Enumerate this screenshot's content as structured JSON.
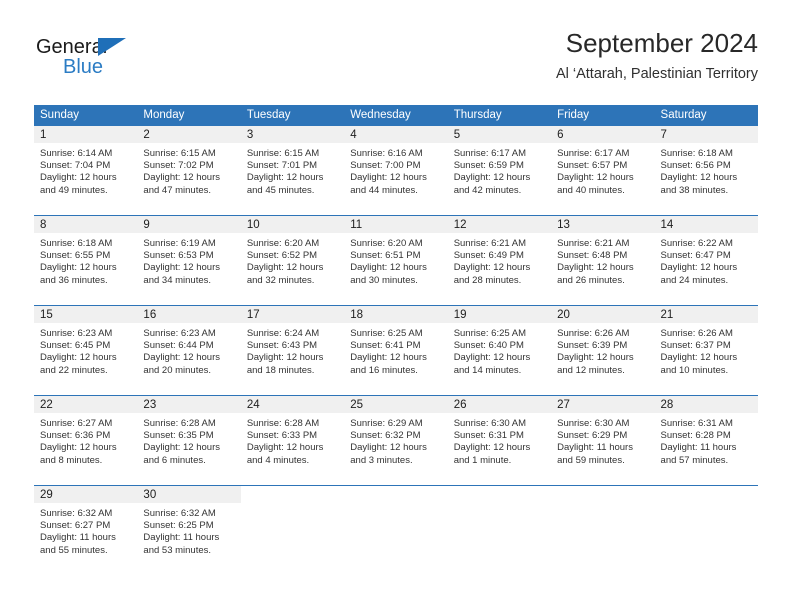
{
  "brand": {
    "name_top": "General",
    "name_bottom": "Blue",
    "triangle_color": "#1f6fb8",
    "blue_text_color": "#2b7cc4"
  },
  "header": {
    "title": "September 2024",
    "subtitle": "Al ‘Attarah, Palestinian Territory"
  },
  "theme": {
    "header_blue": "#2d74b8",
    "day_band_gray": "#f0f0f0",
    "text_color": "#333333"
  },
  "weekdays": [
    "Sunday",
    "Monday",
    "Tuesday",
    "Wednesday",
    "Thursday",
    "Friday",
    "Saturday"
  ],
  "weeks": [
    [
      {
        "day": "1",
        "sunrise": "Sunrise: 6:14 AM",
        "sunset": "Sunset: 7:04 PM",
        "daylight": "Daylight: 12 hours and 49 minutes."
      },
      {
        "day": "2",
        "sunrise": "Sunrise: 6:15 AM",
        "sunset": "Sunset: 7:02 PM",
        "daylight": "Daylight: 12 hours and 47 minutes."
      },
      {
        "day": "3",
        "sunrise": "Sunrise: 6:15 AM",
        "sunset": "Sunset: 7:01 PM",
        "daylight": "Daylight: 12 hours and 45 minutes."
      },
      {
        "day": "4",
        "sunrise": "Sunrise: 6:16 AM",
        "sunset": "Sunset: 7:00 PM",
        "daylight": "Daylight: 12 hours and 44 minutes."
      },
      {
        "day": "5",
        "sunrise": "Sunrise: 6:17 AM",
        "sunset": "Sunset: 6:59 PM",
        "daylight": "Daylight: 12 hours and 42 minutes."
      },
      {
        "day": "6",
        "sunrise": "Sunrise: 6:17 AM",
        "sunset": "Sunset: 6:57 PM",
        "daylight": "Daylight: 12 hours and 40 minutes."
      },
      {
        "day": "7",
        "sunrise": "Sunrise: 6:18 AM",
        "sunset": "Sunset: 6:56 PM",
        "daylight": "Daylight: 12 hours and 38 minutes."
      }
    ],
    [
      {
        "day": "8",
        "sunrise": "Sunrise: 6:18 AM",
        "sunset": "Sunset: 6:55 PM",
        "daylight": "Daylight: 12 hours and 36 minutes."
      },
      {
        "day": "9",
        "sunrise": "Sunrise: 6:19 AM",
        "sunset": "Sunset: 6:53 PM",
        "daylight": "Daylight: 12 hours and 34 minutes."
      },
      {
        "day": "10",
        "sunrise": "Sunrise: 6:20 AM",
        "sunset": "Sunset: 6:52 PM",
        "daylight": "Daylight: 12 hours and 32 minutes."
      },
      {
        "day": "11",
        "sunrise": "Sunrise: 6:20 AM",
        "sunset": "Sunset: 6:51 PM",
        "daylight": "Daylight: 12 hours and 30 minutes."
      },
      {
        "day": "12",
        "sunrise": "Sunrise: 6:21 AM",
        "sunset": "Sunset: 6:49 PM",
        "daylight": "Daylight: 12 hours and 28 minutes."
      },
      {
        "day": "13",
        "sunrise": "Sunrise: 6:21 AM",
        "sunset": "Sunset: 6:48 PM",
        "daylight": "Daylight: 12 hours and 26 minutes."
      },
      {
        "day": "14",
        "sunrise": "Sunrise: 6:22 AM",
        "sunset": "Sunset: 6:47 PM",
        "daylight": "Daylight: 12 hours and 24 minutes."
      }
    ],
    [
      {
        "day": "15",
        "sunrise": "Sunrise: 6:23 AM",
        "sunset": "Sunset: 6:45 PM",
        "daylight": "Daylight: 12 hours and 22 minutes."
      },
      {
        "day": "16",
        "sunrise": "Sunrise: 6:23 AM",
        "sunset": "Sunset: 6:44 PM",
        "daylight": "Daylight: 12 hours and 20 minutes."
      },
      {
        "day": "17",
        "sunrise": "Sunrise: 6:24 AM",
        "sunset": "Sunset: 6:43 PM",
        "daylight": "Daylight: 12 hours and 18 minutes."
      },
      {
        "day": "18",
        "sunrise": "Sunrise: 6:25 AM",
        "sunset": "Sunset: 6:41 PM",
        "daylight": "Daylight: 12 hours and 16 minutes."
      },
      {
        "day": "19",
        "sunrise": "Sunrise: 6:25 AM",
        "sunset": "Sunset: 6:40 PM",
        "daylight": "Daylight: 12 hours and 14 minutes."
      },
      {
        "day": "20",
        "sunrise": "Sunrise: 6:26 AM",
        "sunset": "Sunset: 6:39 PM",
        "daylight": "Daylight: 12 hours and 12 minutes."
      },
      {
        "day": "21",
        "sunrise": "Sunrise: 6:26 AM",
        "sunset": "Sunset: 6:37 PM",
        "daylight": "Daylight: 12 hours and 10 minutes."
      }
    ],
    [
      {
        "day": "22",
        "sunrise": "Sunrise: 6:27 AM",
        "sunset": "Sunset: 6:36 PM",
        "daylight": "Daylight: 12 hours and 8 minutes."
      },
      {
        "day": "23",
        "sunrise": "Sunrise: 6:28 AM",
        "sunset": "Sunset: 6:35 PM",
        "daylight": "Daylight: 12 hours and 6 minutes."
      },
      {
        "day": "24",
        "sunrise": "Sunrise: 6:28 AM",
        "sunset": "Sunset: 6:33 PM",
        "daylight": "Daylight: 12 hours and 4 minutes."
      },
      {
        "day": "25",
        "sunrise": "Sunrise: 6:29 AM",
        "sunset": "Sunset: 6:32 PM",
        "daylight": "Daylight: 12 hours and 3 minutes."
      },
      {
        "day": "26",
        "sunrise": "Sunrise: 6:30 AM",
        "sunset": "Sunset: 6:31 PM",
        "daylight": "Daylight: 12 hours and 1 minute."
      },
      {
        "day": "27",
        "sunrise": "Sunrise: 6:30 AM",
        "sunset": "Sunset: 6:29 PM",
        "daylight": "Daylight: 11 hours and 59 minutes."
      },
      {
        "day": "28",
        "sunrise": "Sunrise: 6:31 AM",
        "sunset": "Sunset: 6:28 PM",
        "daylight": "Daylight: 11 hours and 57 minutes."
      }
    ],
    [
      {
        "day": "29",
        "sunrise": "Sunrise: 6:32 AM",
        "sunset": "Sunset: 6:27 PM",
        "daylight": "Daylight: 11 hours and 55 minutes."
      },
      {
        "day": "30",
        "sunrise": "Sunrise: 6:32 AM",
        "sunset": "Sunset: 6:25 PM",
        "daylight": "Daylight: 11 hours and 53 minutes."
      },
      {
        "day": "",
        "sunrise": "",
        "sunset": "",
        "daylight": ""
      },
      {
        "day": "",
        "sunrise": "",
        "sunset": "",
        "daylight": ""
      },
      {
        "day": "",
        "sunrise": "",
        "sunset": "",
        "daylight": ""
      },
      {
        "day": "",
        "sunrise": "",
        "sunset": "",
        "daylight": ""
      },
      {
        "day": "",
        "sunrise": "",
        "sunset": "",
        "daylight": ""
      }
    ]
  ]
}
